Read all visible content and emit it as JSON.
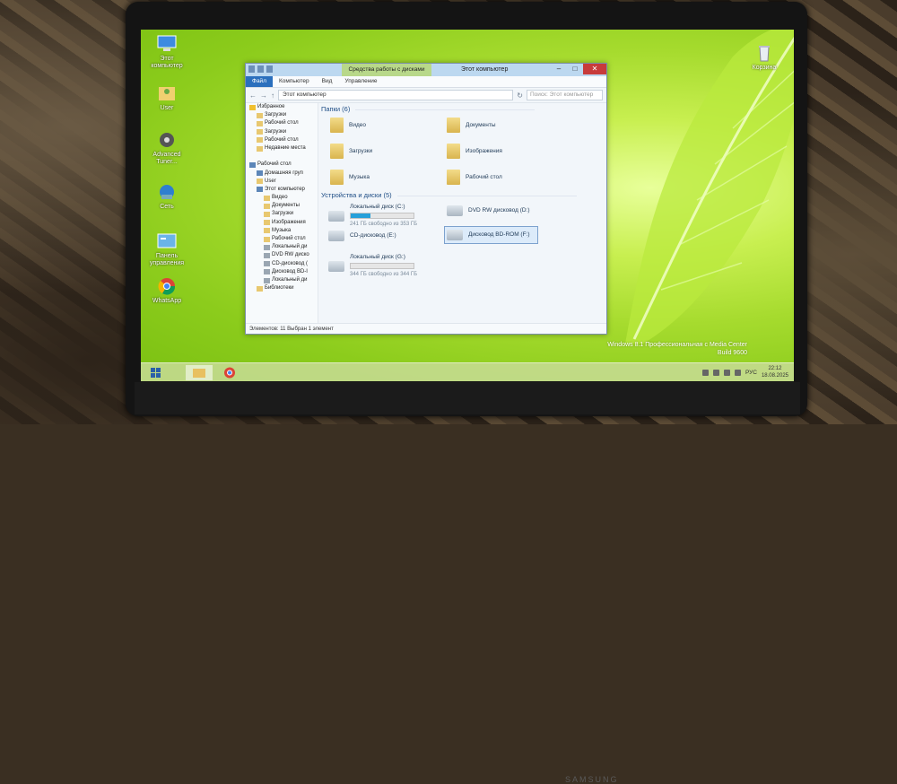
{
  "desktop": {
    "icons_left": [
      {
        "label": "Этот компьютер",
        "icon": "computer-icon"
      },
      {
        "label": "User",
        "icon": "user-folder-icon"
      },
      {
        "label": "Advanced Tuner...",
        "icon": "tuner-app-icon"
      },
      {
        "label": "Сеть",
        "icon": "network-icon"
      },
      {
        "label": "Панель управления",
        "icon": "control-panel-icon"
      },
      {
        "label": "WhatsApp",
        "icon": "chrome-app-icon"
      }
    ],
    "recycle_bin": {
      "label": "Корзина",
      "icon": "recycle-bin-icon"
    },
    "watermark": [
      "Windows 8.1 Профессиональная с Media Center",
      "Build 9600"
    ]
  },
  "window": {
    "ribbon_context_tab": "Средства работы с дисками",
    "title": "Этот компьютер",
    "ribbon_tabs": [
      "Файл",
      "Компьютер",
      "Вид",
      "Управление"
    ],
    "address": "Этот компьютер",
    "search_placeholder": "Поиск: Этот компьютер",
    "nav": [
      {
        "label": "Избранное",
        "kind": "star",
        "indent": 0
      },
      {
        "label": "Загрузки",
        "kind": "fol",
        "indent": 1
      },
      {
        "label": "Рабочий стол",
        "kind": "fol",
        "indent": 1
      },
      {
        "label": "Загрузки",
        "kind": "fol",
        "indent": 1
      },
      {
        "label": "Рабочий стол",
        "kind": "fol",
        "indent": 1
      },
      {
        "label": "Недавние места",
        "kind": "fol",
        "indent": 1
      },
      {
        "label": "",
        "kind": "",
        "indent": 0
      },
      {
        "label": "Рабочий стол",
        "kind": "pc",
        "indent": 0
      },
      {
        "label": "Домашняя груп",
        "kind": "pc",
        "indent": 1
      },
      {
        "label": "User",
        "kind": "fol",
        "indent": 1
      },
      {
        "label": "Этот компьютер",
        "kind": "pc",
        "indent": 1
      },
      {
        "label": "Видео",
        "kind": "fol",
        "indent": 2
      },
      {
        "label": "Документы",
        "kind": "fol",
        "indent": 2
      },
      {
        "label": "Загрузки",
        "kind": "fol",
        "indent": 2
      },
      {
        "label": "Изображения",
        "kind": "fol",
        "indent": 2
      },
      {
        "label": "Музыка",
        "kind": "fol",
        "indent": 2
      },
      {
        "label": "Рабочий стол",
        "kind": "fol",
        "indent": 2
      },
      {
        "label": "Локальный ди",
        "kind": "drv",
        "indent": 2
      },
      {
        "label": "DVD RW диско",
        "kind": "drv",
        "indent": 2
      },
      {
        "label": "CD-дисковод (",
        "kind": "drv",
        "indent": 2
      },
      {
        "label": "Дисковод BD-I",
        "kind": "drv",
        "indent": 2
      },
      {
        "label": "Локальный ди",
        "kind": "drv",
        "indent": 2
      },
      {
        "label": "Библиотеки",
        "kind": "fol",
        "indent": 1
      }
    ],
    "folders_header": "Папки (6)",
    "folders": [
      "Видео",
      "Документы",
      "Загрузки",
      "Изображения",
      "Музыка",
      "Рабочий стол"
    ],
    "drives_header": "Устройства и диски (5)",
    "drives": [
      {
        "name": "Локальный диск (C:)",
        "free": "241 ГБ свободно из 353 ГБ",
        "used_fraction": 0.32,
        "has_bar": true
      },
      {
        "name": "DVD RW дисковод (D:)",
        "free": "",
        "has_bar": false
      },
      {
        "name": "CD-дисковод (E:)",
        "free": "",
        "has_bar": false
      },
      {
        "name": "Дисковод BD-ROM (F:)",
        "free": "",
        "has_bar": false,
        "selected": true
      },
      {
        "name": "Локальный диск (G:)",
        "free": "344 ГБ свободно из 344 ГБ",
        "used_fraction": 0.0,
        "has_bar": true
      }
    ],
    "status": "Элементов: 11     Выбран 1 элемент"
  },
  "taskbar": {
    "tray_lang": "РУС",
    "time": "22:12",
    "date": "18.08.2025"
  },
  "colors": {
    "accent": "#2b6fbd",
    "close": "#c73b3b",
    "context_tab": "#b8d88a"
  }
}
